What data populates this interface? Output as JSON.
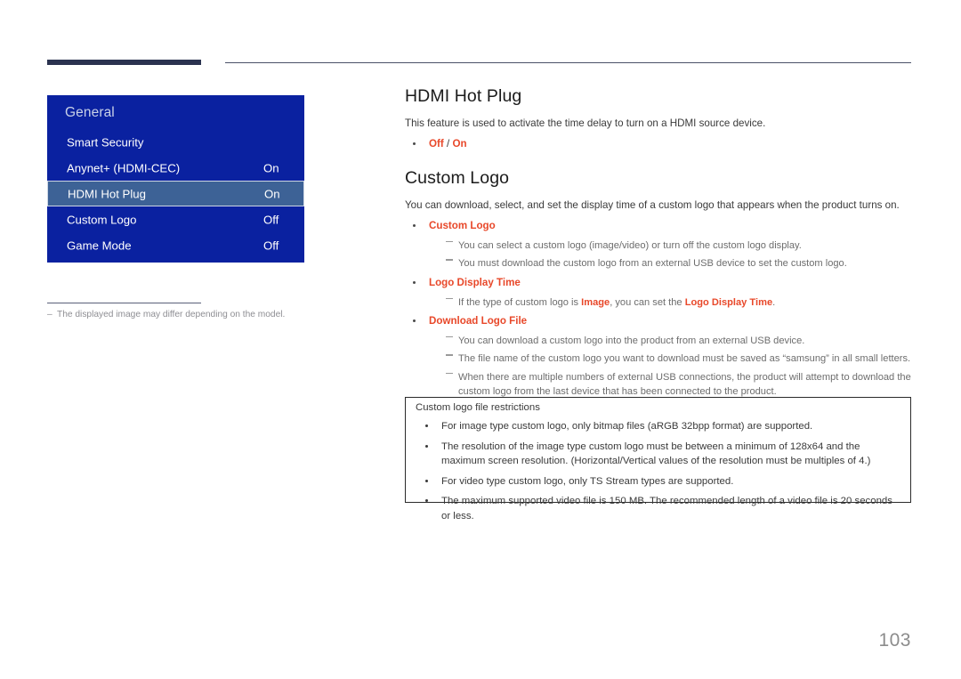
{
  "page": {
    "number": "103"
  },
  "osd": {
    "title": "General",
    "rows": [
      {
        "label": "Smart Security",
        "value": ""
      },
      {
        "label": "Anynet+ (HDMI-CEC)",
        "value": "On"
      },
      {
        "label": "HDMI Hot Plug",
        "value": "On",
        "selected": true
      },
      {
        "label": "Custom Logo",
        "value": "Off"
      },
      {
        "label": "Game Mode",
        "value": "Off"
      }
    ],
    "footnote": "The displayed image may differ depending on the model.",
    "footnote_dash": "–"
  },
  "sections": {
    "hdmi_hot_plug": {
      "heading": "HDMI Hot Plug",
      "intro": "This feature is used to activate the time delay to turn on a HDMI source device.",
      "option_off": "Off",
      "option_separator": "/",
      "option_on": "On"
    },
    "custom_logo": {
      "heading": "Custom Logo",
      "intro": "You can download, select, and set the display time of a custom logo that appears when the product turns on.",
      "item1_label": "Custom Logo",
      "item1_sub1": "You can select a custom logo (image/video) or turn off the custom logo display.",
      "item1_sub2": "You must download the custom logo from an external USB device to set the custom logo.",
      "item2_label": "Logo Display Time",
      "item2_sub1_pre": "If the type of custom logo is ",
      "item2_sub1_accent1": "Image",
      "item2_sub1_mid": ", you can set the ",
      "item2_sub1_accent2": "Logo Display Time",
      "item2_sub1_post": ".",
      "item3_label": "Download Logo File",
      "item3_sub1": "You can download a custom logo into the product from an external USB device.",
      "item3_sub2": "The file name of the custom logo you want to download must be saved as “samsung” in all small letters.",
      "item3_sub3": "When there are multiple numbers of external USB connections, the product will attempt to download the custom logo from the last device that has been connected to the product."
    }
  },
  "restrictions_box": {
    "title": "Custom logo file restrictions",
    "items": [
      "For image type custom logo, only bitmap files (aRGB 32bpp format) are supported.",
      "The resolution of the image type custom logo must be between a minimum of 128x64 and the maximum screen resolution. (Horizontal/Vertical values of the resolution must be multiples of 4.)",
      "For video type custom logo, only TS Stream types are supported.",
      "The maximum supported video file is 150 MB. The recommended length of a video file is 20 seconds or less."
    ]
  },
  "colors": {
    "panel_blue": "#0a21a0",
    "panel_selected": "#3d6296",
    "accent_orange": "#e8482a",
    "rule_navy": "#2b3350"
  }
}
